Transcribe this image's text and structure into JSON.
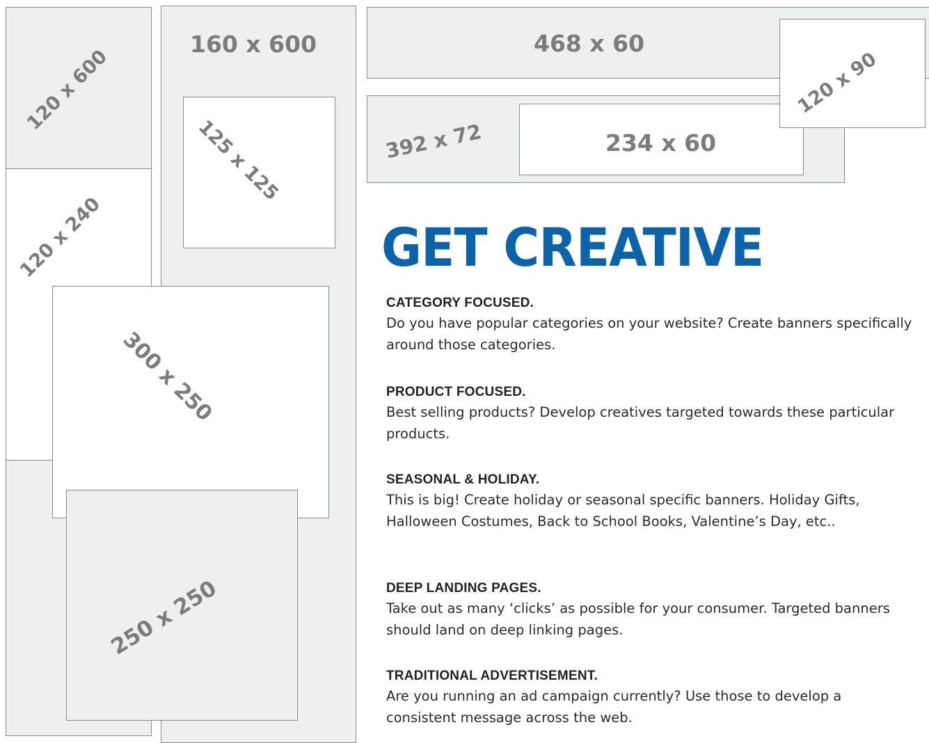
{
  "banners": [
    {
      "id": "b120x600",
      "label": "120 x 600"
    },
    {
      "id": "b160x600",
      "label": "160 x 600"
    },
    {
      "id": "b125x125",
      "label": "125 x 125"
    },
    {
      "id": "b120x240",
      "label": "120 x 240"
    },
    {
      "id": "b300x250",
      "label": "300 x 250"
    },
    {
      "id": "b250x250",
      "label": "250 x 250"
    },
    {
      "id": "b468x60",
      "label": "468 x 60"
    },
    {
      "id": "b392x72",
      "label": "392 x 72"
    },
    {
      "id": "b234x60",
      "label": "234 x 60"
    },
    {
      "id": "b120x90",
      "label": "120 x 90"
    }
  ],
  "headline": "GET CREATIVE",
  "sections": [
    {
      "heading": "CATEGORY FOCUSED.",
      "body": "Do you have popular categories on your website? Create banners specifically around those categories."
    },
    {
      "heading": "PRODUCT FOCUSED.",
      "body": "Best selling products? Develop creatives targeted towards these particular products."
    },
    {
      "heading": "SEASONAL & HOLIDAY.",
      "body": "This is big! Create holiday or seasonal specific banners. Holiday Gifts, Halloween Costumes, Back to School Books, Valentine’s Day, etc.."
    },
    {
      "heading": "DEEP LANDING PAGES.",
      "body": "Take out as many ‘clicks’ as possible for your consumer. Targeted banners should land on deep linking pages."
    },
    {
      "heading": "TRADITIONAL ADVERTISEMENT.",
      "body": "Are you running an ad campaign currently? Use those to develop a consistent message across the web."
    }
  ],
  "colors": {
    "headline": "#0b63a9",
    "box_gray": "#eef0ef",
    "label_gray": "#7c7c7c"
  }
}
